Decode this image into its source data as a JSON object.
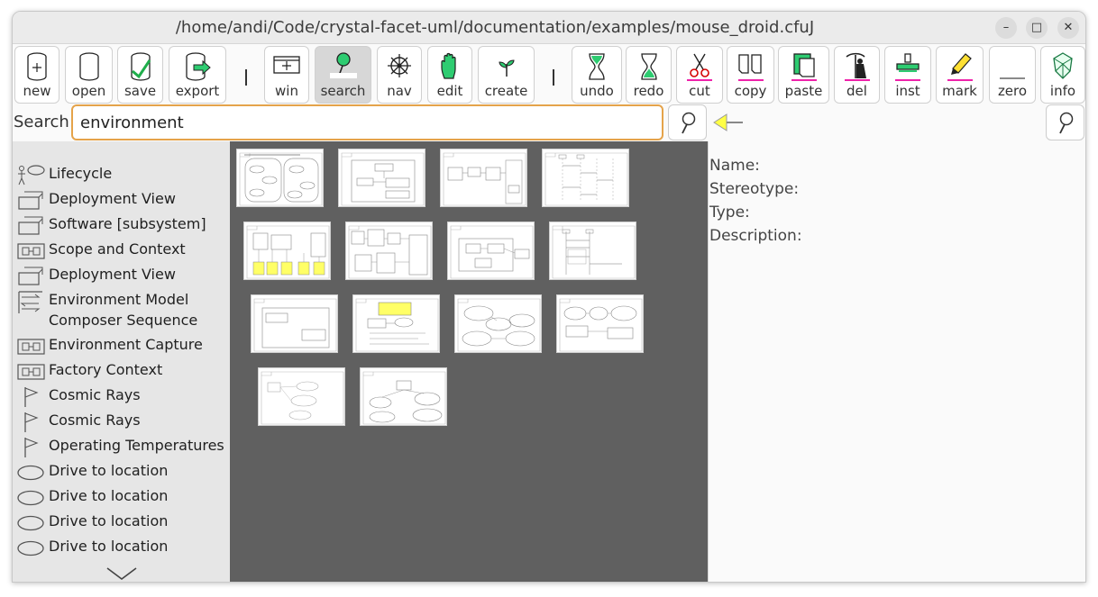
{
  "window": {
    "title": "/home/andi/Code/crystal-facet-uml/documentation/examples/mouse_droid.cfuJ",
    "controls": [
      "minimize",
      "maximize",
      "close"
    ]
  },
  "toolbar": {
    "new": "new",
    "open": "open",
    "save": "save",
    "export": "export",
    "win": "win",
    "search": "search",
    "nav": "nav",
    "edit": "edit",
    "create": "create",
    "undo": "undo",
    "redo": "redo",
    "cut": "cut",
    "copy": "copy",
    "paste": "paste",
    "del": "del",
    "inst": "inst",
    "mark": "mark",
    "zero": "zero",
    "info": "info",
    "active_mode": "search"
  },
  "search": {
    "label": "Search:",
    "value": "environment"
  },
  "results": [
    {
      "label": "Lifecycle",
      "icon": "usecase-actor-icon"
    },
    {
      "label": "Deployment View",
      "icon": "deployment-icon"
    },
    {
      "label": "Software [subsystem]",
      "icon": "deployment-icon"
    },
    {
      "label": "Scope and Context",
      "icon": "block-diagram-icon"
    },
    {
      "label": "Deployment View",
      "icon": "deployment-icon"
    },
    {
      "label": "Environment Model",
      "label2": "Composer Sequence",
      "icon": "sequence-icon"
    },
    {
      "label": "Environment Capture",
      "icon": "block-diagram-icon"
    },
    {
      "label": "Factory Context",
      "icon": "block-diagram-icon"
    },
    {
      "label": "Cosmic Rays",
      "icon": "requirement-flag-icon"
    },
    {
      "label": "Cosmic Rays",
      "icon": "requirement-flag-icon"
    },
    {
      "label": "Operating Temperatures",
      "icon": "requirement-flag-icon"
    },
    {
      "label": "Drive to location",
      "icon": "usecase-ellipse-icon"
    },
    {
      "label": "Drive to location",
      "icon": "usecase-ellipse-icon"
    },
    {
      "label": "Drive to location",
      "icon": "usecase-ellipse-icon"
    },
    {
      "label": "Drive to location",
      "icon": "usecase-ellipse-icon"
    }
  ],
  "properties": {
    "name_label": "Name:",
    "stereotype_label": "Stereotype:",
    "type_label": "Type:",
    "description_label": "Description:"
  },
  "colors": {
    "search_border": "#e5a34a",
    "canvas_bg": "#606060",
    "list_bg": "#e6e6e6",
    "highlight_yellow": "#ffff66",
    "icon_green": "#2ecc71",
    "marker_magenta": "#ee22aa"
  }
}
